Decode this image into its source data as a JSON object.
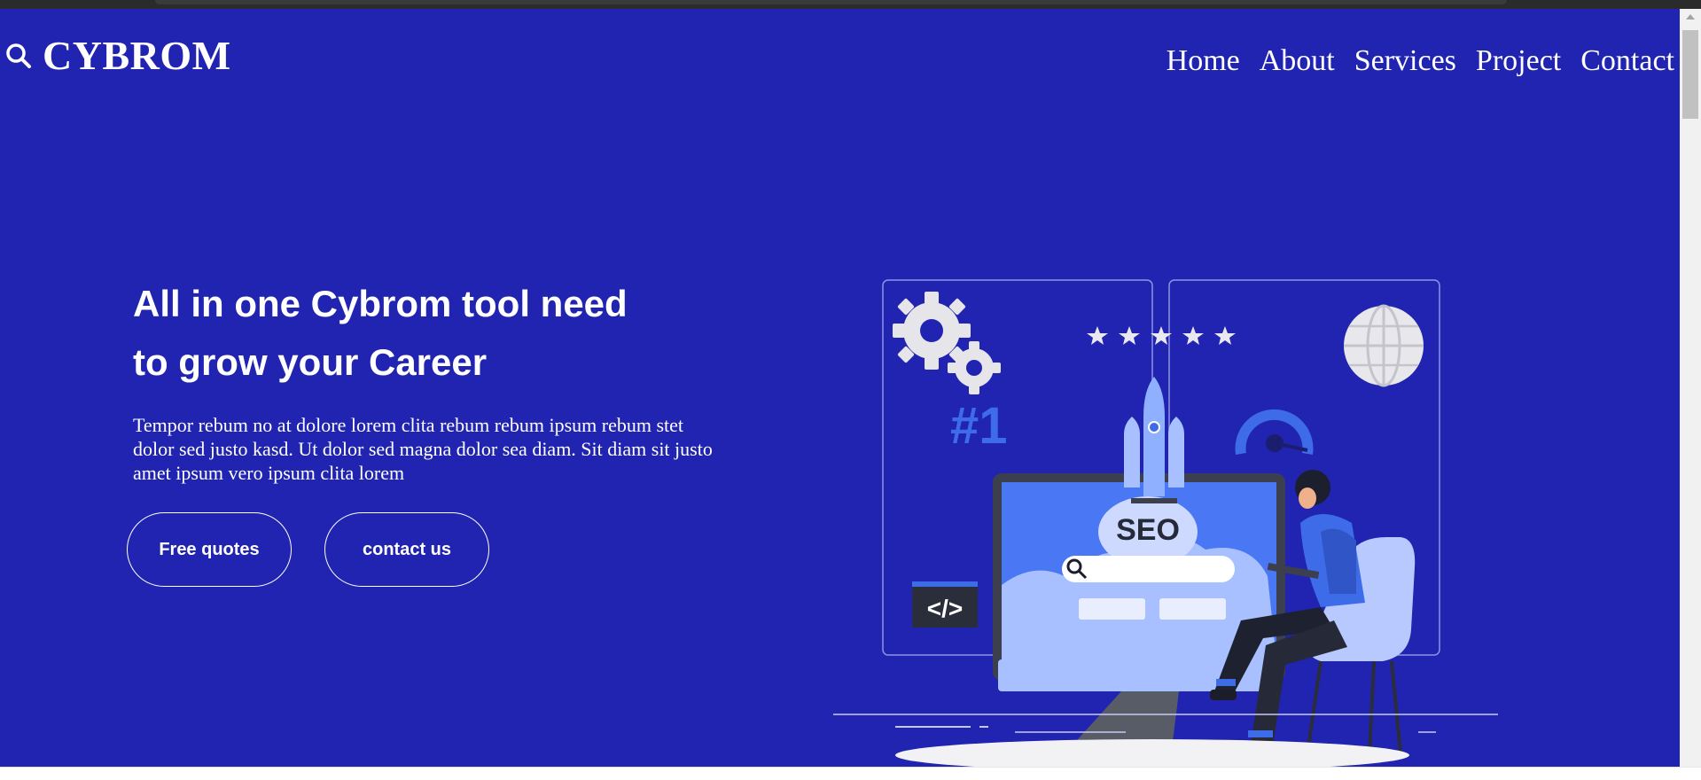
{
  "brand": {
    "name": "CYBROM",
    "icon": "search-icon"
  },
  "nav": {
    "items": [
      "Home",
      "About",
      "Services",
      "Project",
      "Contact"
    ]
  },
  "hero": {
    "headline_line1": "All in one Cybrom tool need",
    "headline_line2": "to grow your Career",
    "blurb": "Tempor rebum no at dolore lorem clita rebum rebum ipsum rebum stet dolor sed justo kasd. Ut dolor sed magna dolor sea diam. Sit diam sit justo amet ipsum vero ipsum clita lorem",
    "buttons": {
      "quotes": "Free quotes",
      "contact": "contact us"
    }
  },
  "illustration": {
    "rank": "#1",
    "screen_word": "SEO",
    "code_tag": "</>"
  },
  "colors": {
    "background": "#2124b1",
    "accent": "#3e6be8",
    "text": "#ffffff"
  }
}
